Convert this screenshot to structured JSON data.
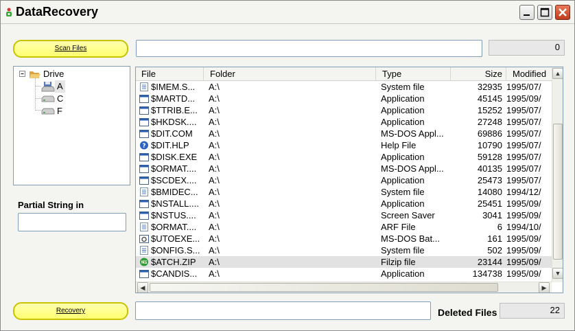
{
  "window": {
    "title": "DataRecovery"
  },
  "top": {
    "scan_label": "Scan Files",
    "path_value": "",
    "count_value": "0"
  },
  "tree": {
    "root": "Drive",
    "items": [
      {
        "label": "A",
        "icon": "floppy-drive-icon"
      },
      {
        "label": "C",
        "icon": "hard-drive-icon"
      },
      {
        "label": "F",
        "icon": "hard-drive-icon"
      }
    ]
  },
  "partial": {
    "label": "Partial String in",
    "value": ""
  },
  "table": {
    "columns": [
      "File",
      "Folder",
      "Type",
      "Size",
      "Modified"
    ],
    "rows": [
      {
        "file": "$IMEM.S...",
        "folder": "A:\\",
        "type": "System file",
        "size": "32935",
        "modified": "1995/07/",
        "icon": "system-file-icon"
      },
      {
        "file": "$MARTD...",
        "folder": "A:\\",
        "type": "Application",
        "size": "45145",
        "modified": "1995/09/",
        "icon": "application-icon"
      },
      {
        "file": "$TTRIB.E...",
        "folder": "A:\\",
        "type": "Application",
        "size": "15252",
        "modified": "1995/07/",
        "icon": "application-icon"
      },
      {
        "file": "$HKDSK....",
        "folder": "A:\\",
        "type": "Application",
        "size": "27248",
        "modified": "1995/07/",
        "icon": "application-icon"
      },
      {
        "file": "$DIT.COM",
        "folder": "A:\\",
        "type": "MS-DOS Appl...",
        "size": "69886",
        "modified": "1995/07/",
        "icon": "application-icon"
      },
      {
        "file": "$DIT.HLP",
        "folder": "A:\\",
        "type": "Help File",
        "size": "10790",
        "modified": "1995/07/",
        "icon": "help-file-icon"
      },
      {
        "file": "$DISK.EXE",
        "folder": "A:\\",
        "type": "Application",
        "size": "59128",
        "modified": "1995/07/",
        "icon": "application-icon"
      },
      {
        "file": "$ORMAT....",
        "folder": "A:\\",
        "type": "MS-DOS Appl...",
        "size": "40135",
        "modified": "1995/07/",
        "icon": "application-icon"
      },
      {
        "file": "$SCDEX....",
        "folder": "A:\\",
        "type": "Application",
        "size": "25473",
        "modified": "1995/07/",
        "icon": "application-icon"
      },
      {
        "file": "$BMIDEC...",
        "folder": "A:\\",
        "type": "System file",
        "size": "14080",
        "modified": "1994/12/",
        "icon": "system-file-icon"
      },
      {
        "file": "$NSTALL....",
        "folder": "A:\\",
        "type": "Application",
        "size": "25451",
        "modified": "1995/09/",
        "icon": "application-icon"
      },
      {
        "file": "$NSTUS....",
        "folder": "A:\\",
        "type": "Screen Saver",
        "size": "3041",
        "modified": "1995/09/",
        "icon": "application-icon"
      },
      {
        "file": "$ORMAT....",
        "folder": "A:\\",
        "type": "ARF File",
        "size": "6",
        "modified": "1994/10/",
        "icon": "system-file-icon"
      },
      {
        "file": "$UTOEXE...",
        "folder": "A:\\",
        "type": "MS-DOS Bat...",
        "size": "161",
        "modified": "1995/09/",
        "icon": "batch-file-icon"
      },
      {
        "file": "$ONFIG.S...",
        "folder": "A:\\",
        "type": "System file",
        "size": "502",
        "modified": "1995/09/",
        "icon": "system-file-icon"
      },
      {
        "file": "$ATCH.ZIP",
        "folder": "A:\\",
        "type": "Filzip file",
        "size": "23144",
        "modified": "1995/09/",
        "icon": "zip-file-icon"
      },
      {
        "file": "$CANDIS...",
        "folder": "A:\\",
        "type": "Application",
        "size": "134738",
        "modified": "1995/09/",
        "icon": "application-icon"
      }
    ]
  },
  "bottom": {
    "recovery_label": "Recovery",
    "path_value": "",
    "deleted_label": "Deleted Files",
    "deleted_count": "22"
  },
  "colors": {
    "accent_yellow": "#ffff80",
    "selected_row": "#e2e2e2",
    "border": "#7f9db9"
  }
}
